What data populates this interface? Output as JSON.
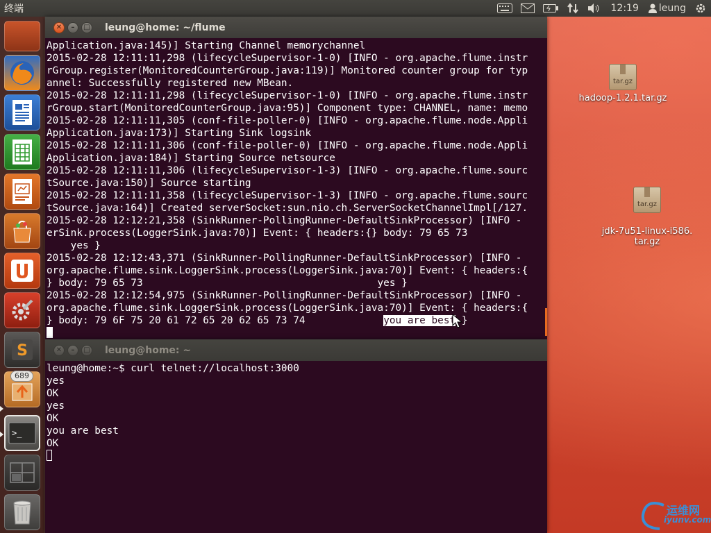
{
  "top_panel": {
    "app_name": "终端",
    "clock": "12:19",
    "user": "leung",
    "icons": [
      "keyboard-icon",
      "mail-icon",
      "battery-icon",
      "network-icon",
      "volume-icon",
      "user-icon",
      "power-gear-icon"
    ]
  },
  "launcher": {
    "items": [
      {
        "name": "files",
        "icon": "file-manager-icon"
      },
      {
        "name": "firefox",
        "icon": "firefox-icon"
      },
      {
        "name": "writer",
        "icon": "libreoffice-writer-icon"
      },
      {
        "name": "calc",
        "icon": "libreoffice-calc-icon"
      },
      {
        "name": "impress",
        "icon": "libreoffice-impress-icon"
      },
      {
        "name": "software-center",
        "icon": "software-center-icon"
      },
      {
        "name": "ubuntu-one",
        "icon": "ubuntu-one-icon"
      },
      {
        "name": "system-settings",
        "icon": "settings-icon"
      },
      {
        "name": "sublime",
        "icon": "sublime-text-icon"
      },
      {
        "name": "update-manager",
        "icon": "update-manager-icon",
        "badge": "689"
      },
      {
        "name": "terminal",
        "icon": "terminal-icon"
      },
      {
        "name": "workspaces",
        "icon": "workspace-switcher-icon"
      },
      {
        "name": "trash",
        "icon": "trash-icon"
      }
    ]
  },
  "terminal_flume": {
    "title": "leung@home: ~/flume",
    "lines": [
      "Application.java:145)] Starting Channel memorychannel",
      "2015-02-28 12:11:11,298 (lifecycleSupervisor-1-0) [INFO - org.apache.flume.instr",
      "rGroup.register(MonitoredCounterGroup.java:119)] Monitored counter group for typ",
      "annel: Successfully registered new MBean.",
      "2015-02-28 12:11:11,298 (lifecycleSupervisor-1-0) [INFO - org.apache.flume.instr",
      "rGroup.start(MonitoredCounterGroup.java:95)] Component type: CHANNEL, name: memo",
      "2015-02-28 12:11:11,305 (conf-file-poller-0) [INFO - org.apache.flume.node.Appli",
      "Application.java:173)] Starting Sink logsink",
      "2015-02-28 12:11:11,306 (conf-file-poller-0) [INFO - org.apache.flume.node.Appli",
      "Application.java:184)] Starting Source netsource",
      "2015-02-28 12:11:11,306 (lifecycleSupervisor-1-3) [INFO - org.apache.flume.sourc",
      "tSource.java:150)] Source starting",
      "2015-02-28 12:11:11,358 (lifecycleSupervisor-1-3) [INFO - org.apache.flume.sourc",
      "tSource.java:164)] Created serverSocket:sun.nio.ch.ServerSocketChannelImpl[/127.",
      "2015-02-28 12:12:21,358 (SinkRunner-PollingRunner-DefaultSinkProcessor) [INFO -",
      "erSink.process(LoggerSink.java:70)] Event: { headers:{} body: 79 65 73",
      "    yes }",
      "2015-02-28 12:12:43,371 (SinkRunner-PollingRunner-DefaultSinkProcessor) [INFO -",
      "org.apache.flume.sink.LoggerSink.process(LoggerSink.java:70)] Event: { headers:{",
      "} body: 79 65 73                                       yes }",
      "2015-02-28 12:12:54,975 (SinkRunner-PollingRunner-DefaultSinkProcessor) [INFO -",
      "org.apache.flume.sink.LoggerSink.process(LoggerSink.java:70)] Event: { headers:{"
    ],
    "last_line_prefix": "} body: 79 6F 75 20 61 72 65 20 62 65 73 74             ",
    "last_line_selected": "you are best",
    "last_line_suffix": " }"
  },
  "terminal_home": {
    "title": "leung@home: ~",
    "lines": [
      "leung@home:~$ curl telnet://localhost:3000",
      "yes",
      "OK",
      "yes",
      "OK",
      "you are best",
      "OK"
    ]
  },
  "desktop_icons": [
    {
      "label": "hadoop-1.2.1.tar.gz",
      "archive_label": "tar.gz"
    },
    {
      "label": "jdk-7u51-linux-i586.\ntar.gz",
      "archive_label": "tar.gz"
    }
  ],
  "watermark": {
    "text": "运维网",
    "url": "iyunv.com"
  }
}
